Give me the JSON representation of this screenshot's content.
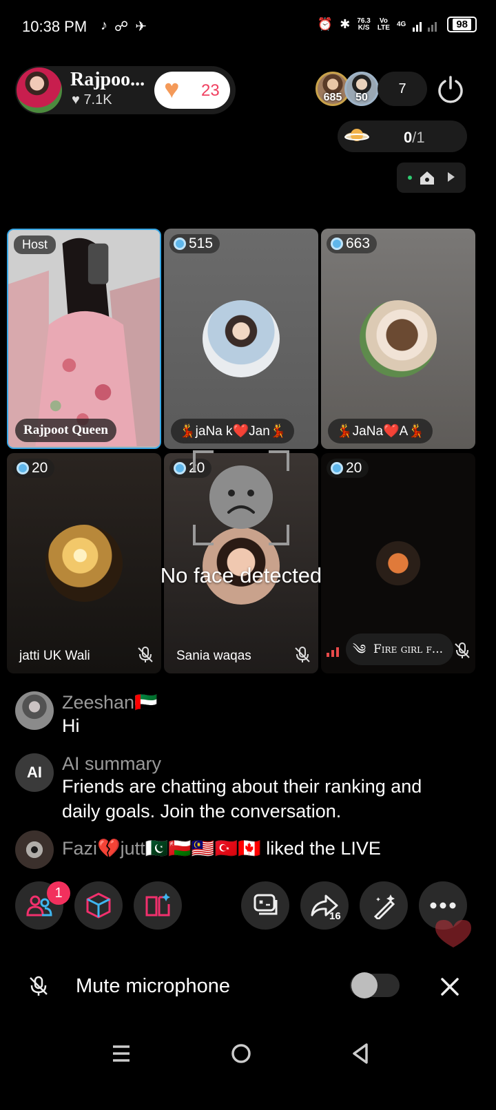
{
  "status_bar": {
    "time": "10:38 PM",
    "net_speed_top": "76.3",
    "net_speed_bottom": "K/S",
    "volte_top": "Vo",
    "volte_bottom": "LTE",
    "network": "4G",
    "battery": "98"
  },
  "host": {
    "name": "Rajpoo...",
    "likes": "7.1K",
    "heart_count": "23"
  },
  "viewers": {
    "avatar1_level": "685",
    "avatar2_level": "50",
    "count": "7"
  },
  "goal": {
    "current": "0",
    "target": "/1"
  },
  "grid": {
    "host_badge": "Host",
    "tiles": [
      {
        "name": "Rajpoot Queen"
      },
      {
        "score": "515",
        "name": "💃jaNa k❤️Jan💃"
      },
      {
        "score": "663",
        "name": "💃JaNa❤️A💃"
      },
      {
        "score": "20",
        "name": "jatti UK Wali"
      },
      {
        "score": "20",
        "name": "Sania waqas"
      },
      {
        "score": "20",
        "name": "Fire girl f..."
      }
    ],
    "no_face_text": "No face detected"
  },
  "comments": [
    {
      "name": "Zeeshan🇦🇪",
      "text": "Hi"
    },
    {
      "name": "AI summary",
      "avatar_label": "AI",
      "text": "Friends are chatting about their ranking and daily goals. Join the conversation."
    },
    {
      "name": "Fazi💔jutt🇵🇰🇴🇲🇲🇾🇹🇷🇨🇦",
      "text": "liked the LIVE"
    }
  ],
  "actions": {
    "notification_count": "1",
    "share_count": "16",
    "icons": [
      "guests-icon",
      "box-icon",
      "book-icon",
      "game-icon",
      "share-icon",
      "magic-wand-icon",
      "more-icon"
    ]
  },
  "mute_bar": {
    "label": "Mute microphone",
    "toggle_on": false
  },
  "colors": {
    "accent_pink": "#f2305d",
    "host_border": "#37a7e5",
    "heart_orange": "#f49a59"
  }
}
